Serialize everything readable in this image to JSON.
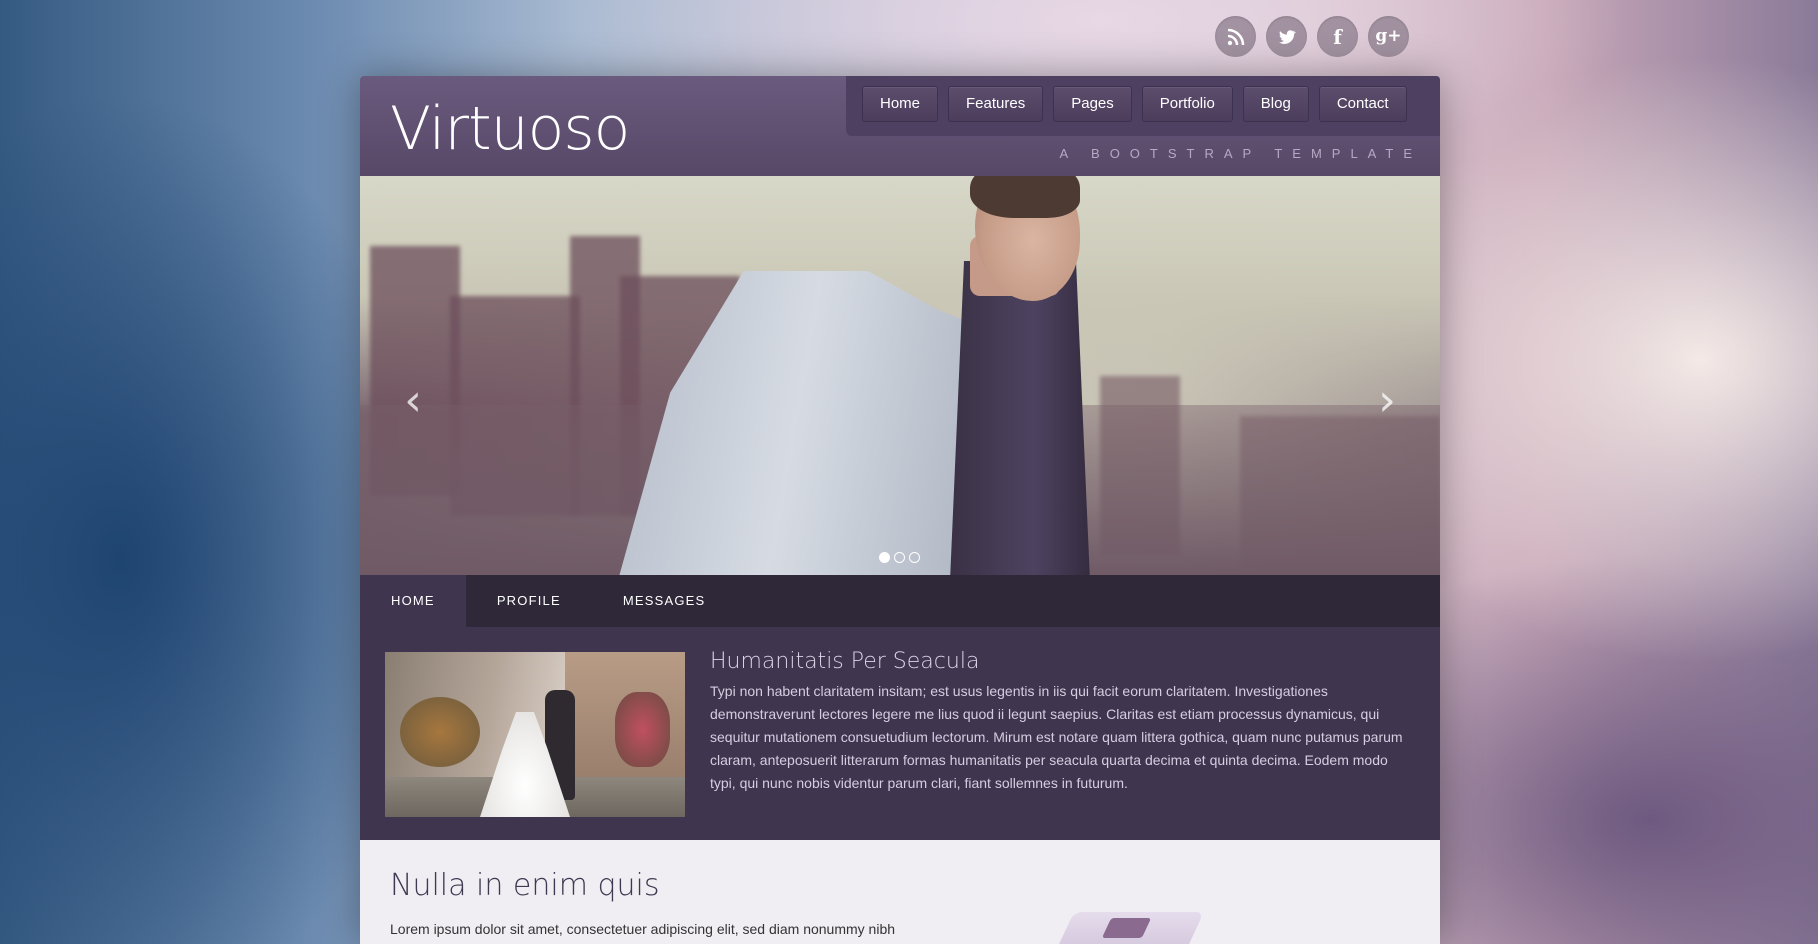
{
  "social": [
    {
      "name": "rss",
      "label": "RSS"
    },
    {
      "name": "twitter",
      "label": "Twitter"
    },
    {
      "name": "facebook",
      "label": "f"
    },
    {
      "name": "googleplus",
      "label": "g+"
    }
  ],
  "header": {
    "logo": "Virtuoso",
    "tagline": "A BOOTSTRAP TEMPLATE"
  },
  "nav": {
    "items": [
      "Home",
      "Features",
      "Pages",
      "Portfolio",
      "Blog",
      "Contact"
    ]
  },
  "carousel": {
    "prev_label": "‹",
    "next_label": "›",
    "slides": 3,
    "active_slide": 1
  },
  "tabs": {
    "items": [
      "HOME",
      "PROFILE",
      "MESSAGES"
    ],
    "active": "HOME"
  },
  "panel": {
    "title": "Humanitatis Per Seacula",
    "text": "Typi non habent claritatem insitam; est usus legentis in iis qui facit eorum claritatem. Investigationes demonstraverunt lectores legere me lius quod ii legunt saepius. Claritas est etiam processus dynamicus, qui sequitur mutationem consuetudium lectorum. Mirum est notare quam littera gothica, quam nunc putamus parum claram, anteposuerit litterarum formas humanitatis per seacula quarta decima et quinta decima. Eodem modo typi, qui nunc nobis videntur parum clari, fiant sollemnes in futurum."
  },
  "lower": {
    "title": "Nulla in enim quis",
    "text": "Lorem ipsum dolor sit amet, consectetuer adipiscing elit, sed diam nonummy nibh euismod tincidunt ut laoreet dolore magna aliquam erat volutpat. Ut wisi enim ad minim"
  },
  "colors": {
    "header": "#5f4f72",
    "nav_button": "#54456a",
    "tabs_bar": "#2f2838",
    "panel": "#40354f",
    "lower": "#f0edf3"
  }
}
